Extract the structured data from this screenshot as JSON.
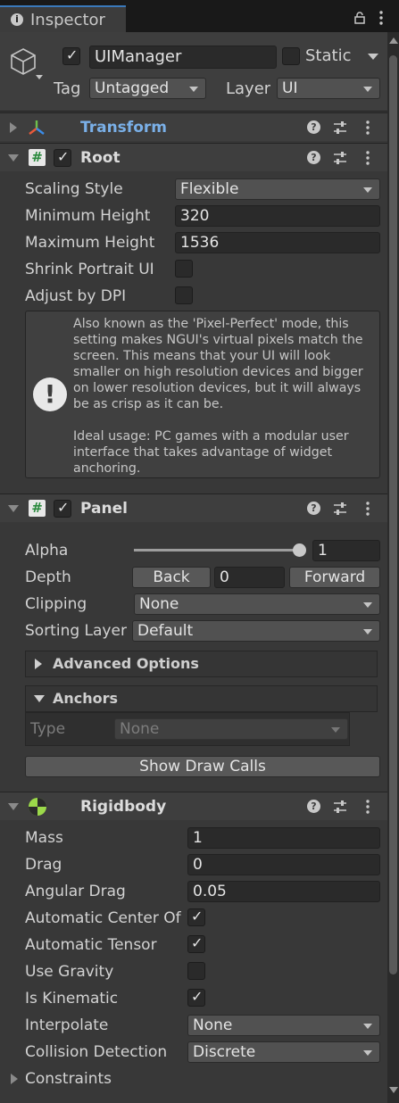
{
  "window": {
    "tab_label": "Inspector",
    "lock_icon": "lock-icon",
    "menu_icon": "kebab-menu-icon"
  },
  "header": {
    "active": true,
    "name_value": "UIManager",
    "static_label": "Static",
    "static_checked": false,
    "tag_label": "Tag",
    "tag_value": "Untagged",
    "layer_label": "Layer",
    "layer_value": "UI"
  },
  "transform": {
    "title": "Transform",
    "expanded": false
  },
  "root": {
    "title": "Root",
    "enabled": true,
    "fields": [
      {
        "label": "Scaling Style",
        "value": "Flexible",
        "kind": "dropdown"
      },
      {
        "label": "Minimum Height",
        "value": "320",
        "kind": "field"
      },
      {
        "label": "Maximum Height",
        "value": "1536",
        "kind": "field"
      },
      {
        "label": "Shrink Portrait UI",
        "checked": false,
        "kind": "check"
      },
      {
        "label": "Adjust by DPI",
        "checked": false,
        "kind": "check"
      }
    ],
    "help_lines": [
      "Also known as the 'Pixel-Perfect' mode, this",
      "setting makes NGUI's virtual pixels match the",
      "screen. This means that your UI will look",
      "smaller on high resolution devices and bigger",
      "on lower resolution devices, but it will always",
      "be as crisp as it can be.",
      "",
      "Ideal usage: PC games with a modular user",
      "interface that takes advantage of widget",
      "anchoring."
    ],
    "help_icon_glyph": "!"
  },
  "panel": {
    "title": "Panel",
    "enabled": true,
    "alpha_label": "Alpha",
    "alpha_value": "1",
    "alpha_level": 1,
    "depth_label": "Depth",
    "depth_back": "Back",
    "depth_value": "0",
    "depth_forward": "Forward",
    "clipping_label": "Clipping",
    "clipping_value": "None",
    "sorting_label": "Sorting Layer",
    "sorting_value": "Default",
    "advanced_label": "Advanced Options",
    "anchors_label": "Anchors",
    "anchors_type_label": "Type",
    "anchors_type_value": "None",
    "draw_calls_button": "Show Draw Calls"
  },
  "rigidbody": {
    "title": "Rigidbody",
    "fields": [
      {
        "label": "Mass",
        "value": "1",
        "kind": "field"
      },
      {
        "label": "Drag",
        "value": "0",
        "kind": "field"
      },
      {
        "label": "Angular Drag",
        "value": "0.05",
        "kind": "field"
      },
      {
        "label": "Automatic Center Of Mass",
        "checked": true,
        "kind": "check"
      },
      {
        "label": "Automatic Tensor",
        "checked": true,
        "kind": "check"
      },
      {
        "label": "Use Gravity",
        "checked": false,
        "kind": "check"
      },
      {
        "label": "Is Kinematic",
        "checked": true,
        "kind": "check"
      },
      {
        "label": "Interpolate",
        "value": "None",
        "kind": "dropdown"
      },
      {
        "label": "Collision Detection",
        "value": "Discrete",
        "kind": "dropdown"
      }
    ],
    "constraints_label": "Constraints"
  },
  "colors": {
    "background": "#383838",
    "transform_title": "#7ab0e8",
    "tab_accent": "#3a79bb"
  }
}
